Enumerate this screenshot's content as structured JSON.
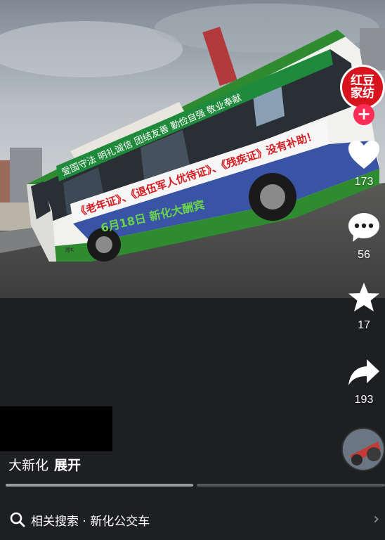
{
  "profile": {
    "brand_line1": "红豆",
    "brand_line2": "家纺",
    "follow_symbol": "+"
  },
  "actions": {
    "like_count": "173",
    "comment_count": "56",
    "favorite_count": "17",
    "share_count": "193"
  },
  "bus": {
    "top_banner": "爱国守法 明礼诚信 团结友善 勤俭自强 敬业奉献",
    "side_banner": "《老年证》、《退伍军人优待证》、《残疾证》没有补助！",
    "lower_ad": "6月18日 新化大酬宾",
    "plate_text": "湘K"
  },
  "caption": {
    "text": "大新化",
    "expand_label": "展开"
  },
  "related_search": {
    "label": "相关搜索 · 新化公交车"
  },
  "colors": {
    "like_red": "#fe2c55",
    "brand_red": "#d7141e",
    "bus_green": "#2e8b2f"
  }
}
